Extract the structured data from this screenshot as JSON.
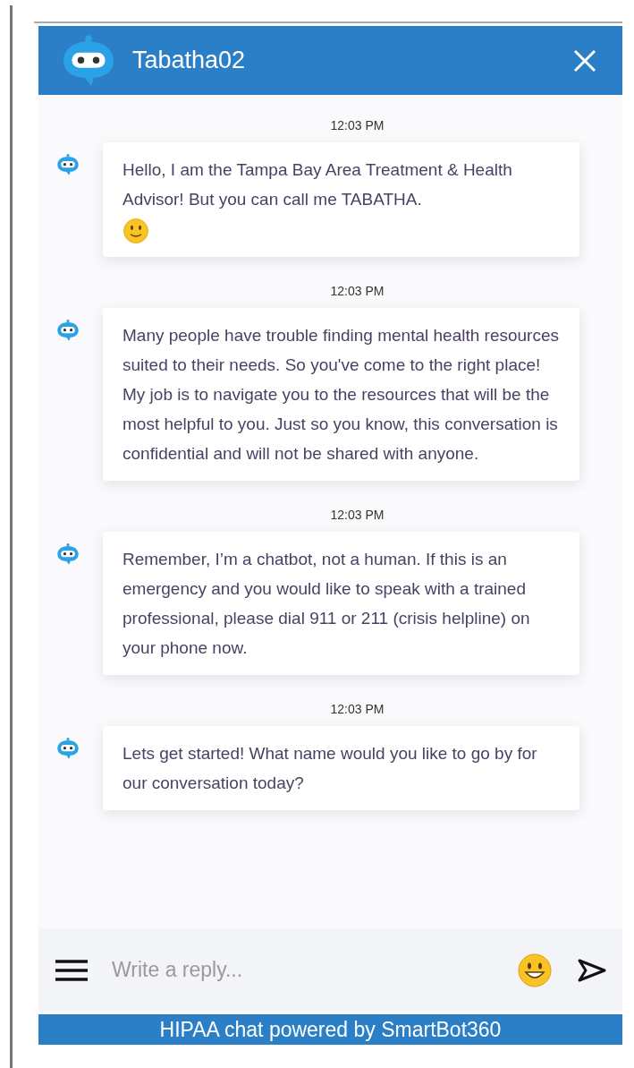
{
  "header": {
    "title": "Tabatha02"
  },
  "messages": [
    {
      "time": "12:03 PM",
      "text": "Hello, I am the Tampa Bay Area Treatment & Health Advisor! But you can call me TABATHA.",
      "smiley": true
    },
    {
      "time": "12:03 PM",
      "text": "Many people have trouble finding mental health resources suited to their needs. So you've come to the right place! My job is to navigate you to the resources that will be the most helpful to you. Just so you know, this conversation is confidential and will not be shared with anyone.",
      "smiley": false
    },
    {
      "time": "12:03 PM",
      "text": "Remember, I’m a chatbot, not a human. If this is an emergency and you would like to speak with a trained professional, please dial 911 or 211 (crisis helpline) on your phone now.",
      "smiley": false
    },
    {
      "time": "12:03 PM",
      "text": "Lets get started! What name would you like to go by for our conversation today?",
      "smiley": false
    }
  ],
  "composer": {
    "placeholder": "Write a reply..."
  },
  "footer": "HIPAA chat powered by SmartBot360"
}
